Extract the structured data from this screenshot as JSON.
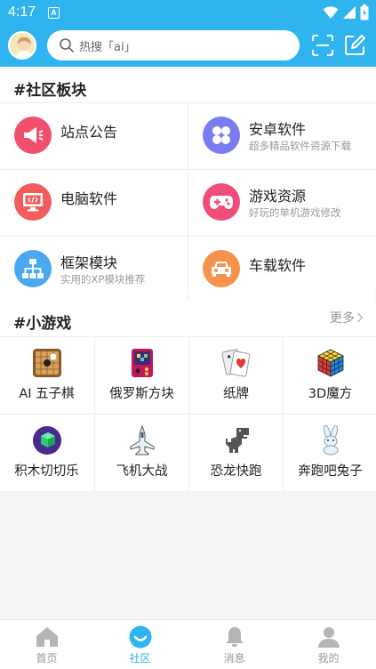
{
  "status_bar": {
    "time": "4:17",
    "notif_letter": "A"
  },
  "search": {
    "placeholder": "热搜「ai」"
  },
  "board": {
    "title": "#社区板块",
    "items": [
      {
        "title": "站点公告",
        "subtitle": "",
        "icon": "megaphone-icon",
        "color": "#f0506e"
      },
      {
        "title": "安卓软件",
        "subtitle": "超多精品软件资源下载",
        "icon": "grid-petals-icon",
        "color": "#7b7cf0"
      },
      {
        "title": "电脑软件",
        "subtitle": "",
        "icon": "monitor-code-icon",
        "color": "#f25c5c"
      },
      {
        "title": "游戏资源",
        "subtitle": "好玩的单机游戏修改",
        "icon": "gamepad-icon",
        "color": "#ef4d7a"
      },
      {
        "title": "框架模块",
        "subtitle": "实用的XP模块推荐",
        "icon": "sitemap-icon",
        "color": "#4aa8f0"
      },
      {
        "title": "车载软件",
        "subtitle": "",
        "icon": "car-icon",
        "color": "#f5924d"
      }
    ]
  },
  "games": {
    "title": "#小游戏",
    "more": "更多",
    "items": [
      {
        "label": "AI 五子棋",
        "icon": "gomoku-board-icon"
      },
      {
        "label": "俄罗斯方块",
        "icon": "tetris-console-icon"
      },
      {
        "label": "纸牌",
        "icon": "playing-cards-icon"
      },
      {
        "label": "3D魔方",
        "icon": "rubiks-cube-icon"
      },
      {
        "label": "积木切切乐",
        "icon": "block-cut-icon"
      },
      {
        "label": "飞机大战",
        "icon": "fighter-jet-icon"
      },
      {
        "label": "恐龙快跑",
        "icon": "dinosaur-icon"
      },
      {
        "label": "奔跑吧兔子",
        "icon": "rabbit-icon"
      }
    ]
  },
  "nav": {
    "items": [
      {
        "label": "首页",
        "icon": "home-icon"
      },
      {
        "label": "社区",
        "icon": "community-icon",
        "active": true
      },
      {
        "label": "消息",
        "icon": "bell-icon"
      },
      {
        "label": "我的",
        "icon": "user-icon"
      }
    ]
  },
  "colors": {
    "accent": "#2fb4f0",
    "background": "#f5f5f5"
  }
}
